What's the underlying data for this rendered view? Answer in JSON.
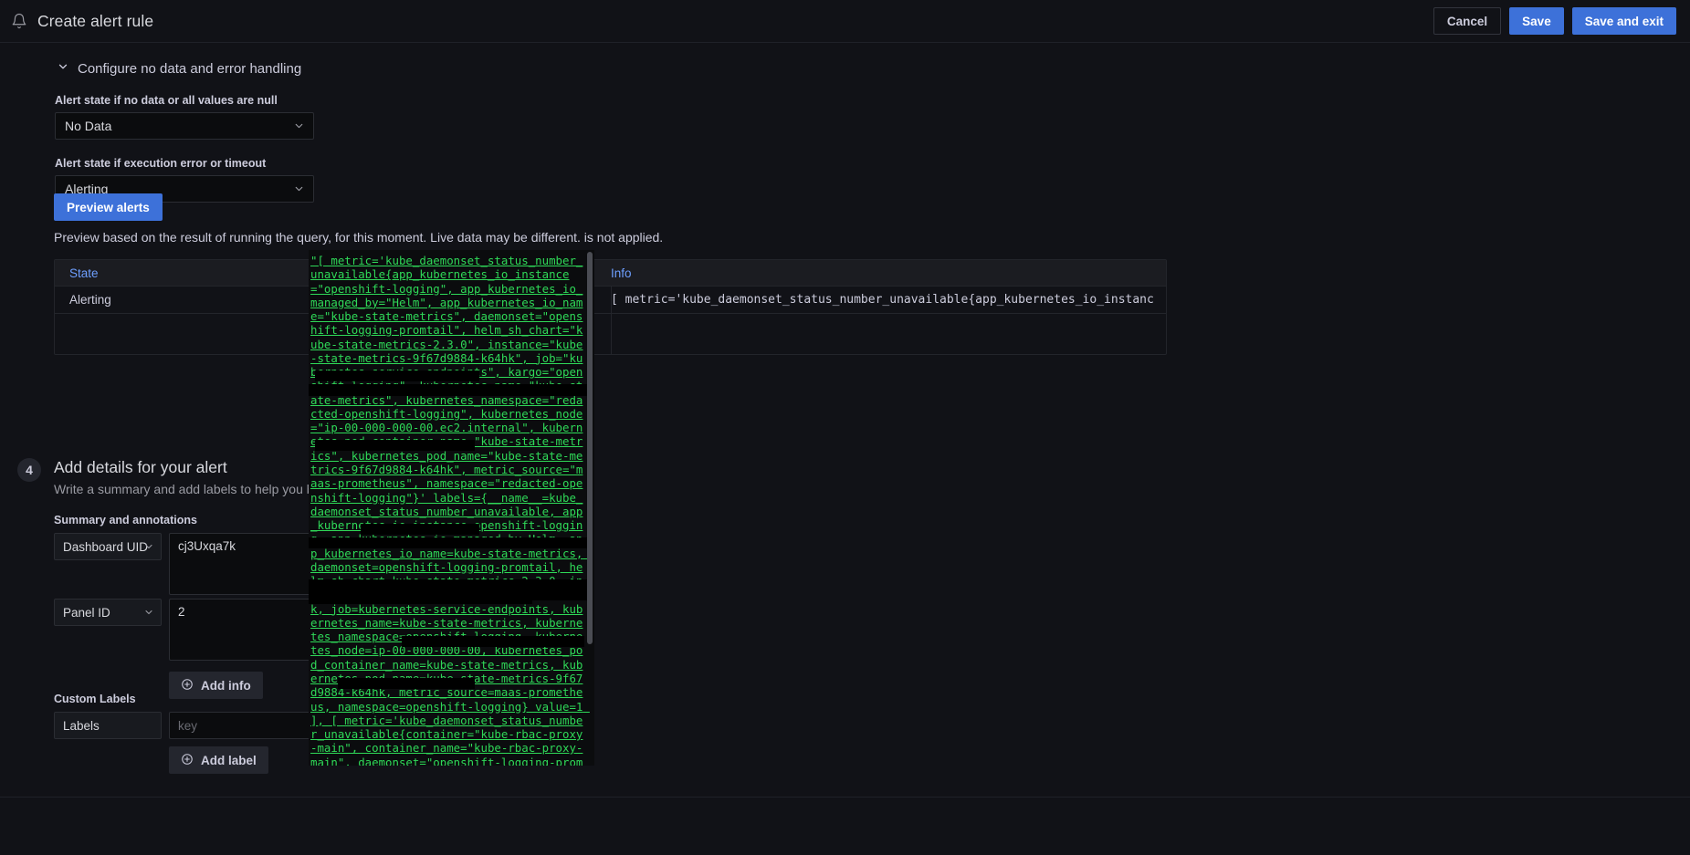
{
  "topbar": {
    "icon": "bell-icon",
    "title": "Create alert rule",
    "cancel_label": "Cancel",
    "save_label": "Save",
    "save_exit_label": "Save and exit"
  },
  "colors": {
    "accent_blue": "#3d71d9",
    "link_blue": "#6e9fff",
    "tooltip_green": "#2fd958",
    "page_bg": "#111217",
    "panel_bg": "#181a1f",
    "input_bg": "#0b0c0e",
    "border": "#2b2d33"
  },
  "no_data_section": {
    "header": "Configure no data and error handling",
    "chevron": "chevron-down-icon",
    "no_data_label": "Alert state if no data or all values are null",
    "no_data_value": "No Data",
    "exec_error_label": "Alert state if execution error or timeout",
    "exec_error_value": "Alerting",
    "preview_button": "Preview alerts",
    "preview_description": "Preview based on the result of running the query, for this moment. Live data may be different. is not applied."
  },
  "preview_table": {
    "columns": [
      "State",
      "Info"
    ],
    "rows": [
      {
        "state": "Alerting",
        "info": "[ metric='kube_daemonset_status_number_unavailable{app_kubernetes_io_instance=\"o…"
      }
    ]
  },
  "step4": {
    "number": "4",
    "title": "Add details for your alert",
    "subtitle": "Write a summary and add labels to help you better",
    "summary_group_label": "Summary and annotations",
    "annotations": [
      {
        "key": "Dashboard UID",
        "value": "cj3Uxqa7k",
        "type": "textarea"
      },
      {
        "key": "Panel ID",
        "value": "2",
        "type": "textarea"
      }
    ],
    "add_info_label": "Add info",
    "add_info_icon": "plus-circle-icon",
    "labels_group_label": "Custom Labels",
    "labels_key_label": "Labels",
    "labels_key_placeholder": "key",
    "labels_key_value": "",
    "add_label_label": "Add label",
    "add_label_icon": "plus-circle-icon"
  },
  "tooltip": {
    "name": "info-cell-tooltip",
    "scrollbar": "vertical-scrollbar",
    "text": "\"[ metric='kube_daemonset_status_number_unavailable{app_kubernetes_io_instance=\"openshift-logging\", app_kubernetes_io_managed_by=\"Helm\", app_kubernetes_io_name=\"kube-state-metrics\", daemonset=\"openshift-logging-promtail\", helm_sh_chart=\"kube-state-metrics-2.3.0\", instance=\"kube-state-metrics-9f67d9884-k64hk\", job=\"kubernetes-service-endpoints\", kargo=\"openshift-logging\", kubernetes_name=\"kube-state-metrics\", kubernetes_namespace=\"redacted-openshift-logging\", kubernetes_node=\"ip-00-000-000-00.ec2.internal\", kubernetes_pod_container_name=\"kube-state-metrics\", kubernetes_pod_name=\"kube-state-metrics-9f67d9884-k64hk\", metric_source=\"maas-prometheus\", namespace=\"redacted-openshift-logging\"}' labels={__name__=kube_daemonset_status_number_unavailable, app_kubernetes_io_instance=openshift-logging, app_kubernetes_io_managed_by=Helm, app_kubernetes_io_name=kube-state-metrics, daemonset=openshift-logging-promtail, helm_sh_chart=kube-state-metrics-2.3.0, instance=kube-state-metrics-9f67d9884-k64hk, job=kubernetes-service-endpoints, kubernetes_name=kube-state-metrics, kubernetes_namespace=openshift-logging, kubernetes_node=ip-00-000-000-00, kubernetes_pod_container_name=kube-state-metrics, kubernetes_pod_name=kube-state-metrics-9f67d9884-k64hk, metric_source=maas-prometheus, namespace=openshift-logging} value=1 ], [ metric='kube_daemonset_status_number_unavailable{container=\"kube-rbac-proxy-main\", container_name=\"kube-rbac-proxy-main\", daemonset=\"openshift-logging-promtail\", endpoint=\"https-main\", job=\"kube-state-metrics\", metric_source=\"federated-openshift-monitoring-prometheus\", namespace=\"openshift-logging\", prometheus=\"openshift-monitoring/k8s\", service=\"kube-state-metri"
  }
}
